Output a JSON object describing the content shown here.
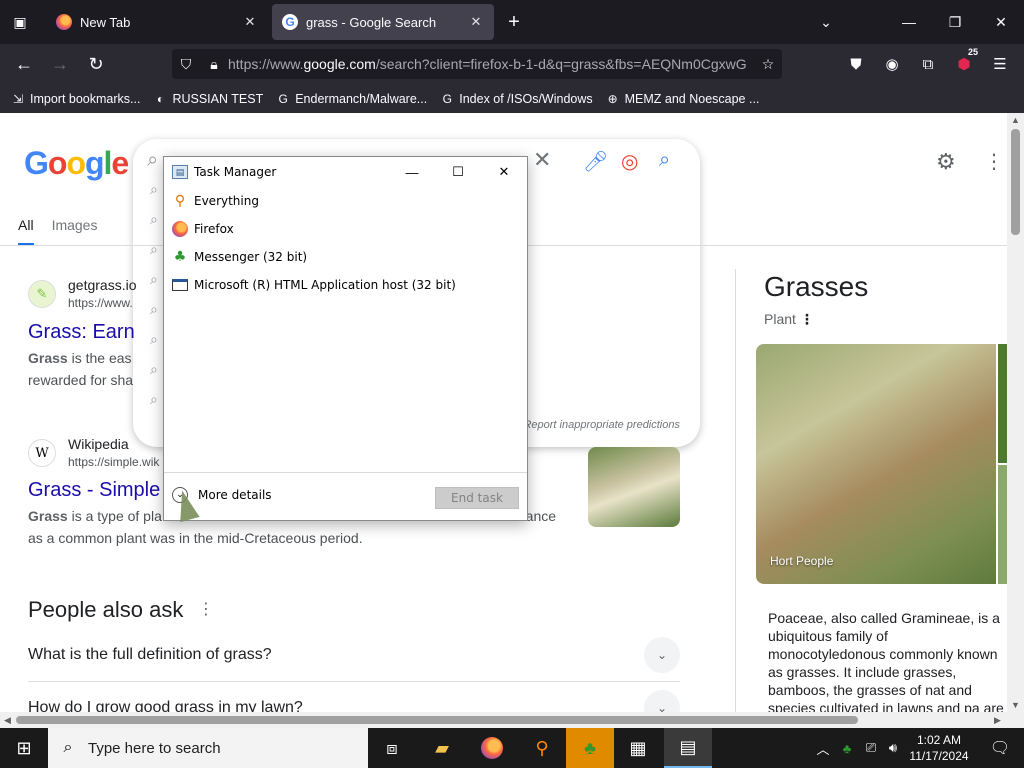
{
  "browser": {
    "tabs": [
      {
        "title": "New Tab",
        "active": false
      },
      {
        "title": "grass - Google Search",
        "active": true
      }
    ],
    "url": {
      "scheme": "https://www.",
      "host": "google.com",
      "rest": "/search?client=firefox-b-1-d&q=grass&fbs=AEQNm0CgxwG"
    },
    "extension_badge": "25",
    "bookmarks": [
      "Import bookmarks...",
      "RUSSIAN TEST",
      "Endermanch/Malware...",
      "Index of /ISOs/Windows",
      "MEMZ and Noescape ..."
    ]
  },
  "google": {
    "logo": "Google",
    "tabs": [
      "All",
      "Images"
    ],
    "report_link": "Report inappropriate predictions",
    "results": [
      {
        "site": "getgrass.io",
        "url": "https://www.",
        "title": "Grass: Earn",
        "snippet_bold": "Grass",
        "snippet_rest": " is the eas",
        "snippet_line2": "rewarded for sha"
      },
      {
        "site": "Wikipedia",
        "url": "https://simple.wik",
        "title": "Grass - Simple",
        "snippet_bold": "Grass",
        "snippet_rest": " is a type of pla",
        "snippet_tail": "rance",
        "snippet_line2": "as a common plant was in the mid-Cretaceous period."
      }
    ],
    "people_also_ask": {
      "title": "People also ask",
      "questions": [
        "What is the full definition of grass?",
        "How do I grow good grass in my lawn?"
      ]
    },
    "knowledge_panel": {
      "title": "Grasses",
      "subtitle": "Plant",
      "image_caption": "Hort People",
      "description": "Poaceae, also called Gramineae, is a ubiquitous family of monocotyledonous commonly known as grasses. It include grasses, bamboos, the grasses of nat and species cultivated in lawns and pa are commonly referred to collectively a"
    }
  },
  "task_manager": {
    "title": "Task Manager",
    "apps": [
      {
        "name": "Everything",
        "icon": "magnifier-icon"
      },
      {
        "name": "Firefox",
        "icon": "firefox-icon"
      },
      {
        "name": "Messenger (32 bit)",
        "icon": "messenger-icon"
      },
      {
        "name": "Microsoft (R) HTML Application host (32 bit)",
        "icon": "window-icon"
      }
    ],
    "more_details": "More details",
    "end_task": "End task"
  },
  "taskbar": {
    "search_placeholder": "Type here to search",
    "time": "1:02 AM",
    "date": "11/17/2024"
  }
}
